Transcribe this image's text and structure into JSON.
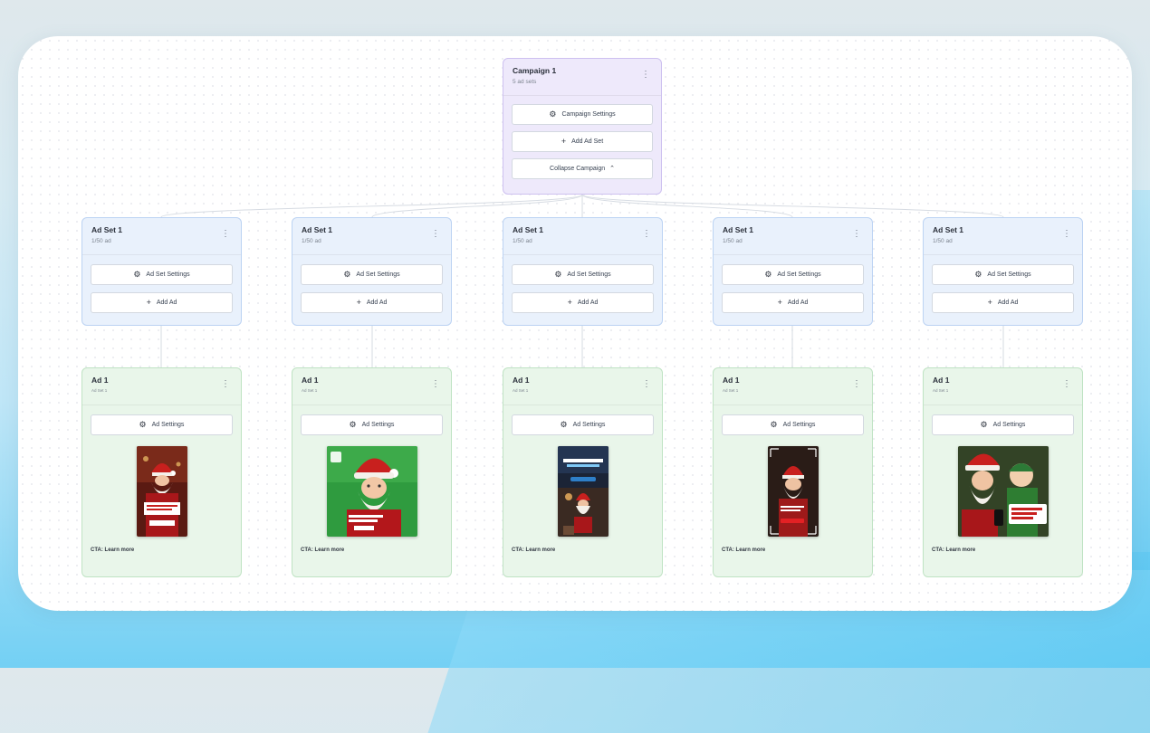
{
  "campaign": {
    "title": "Campaign 1",
    "subtitle": "5 ad sets",
    "settings_label": "Campaign Settings",
    "add_adset_label": "Add Ad Set",
    "collapse_label": "Collapse Campaign"
  },
  "adsets": [
    {
      "title": "Ad Set 1",
      "subtitle": "1/50 ad",
      "settings_label": "Ad Set Settings",
      "add_ad_label": "Add Ad"
    },
    {
      "title": "Ad Set 1",
      "subtitle": "1/50 ad",
      "settings_label": "Ad Set Settings",
      "add_ad_label": "Add Ad"
    },
    {
      "title": "Ad Set 1",
      "subtitle": "1/50 ad",
      "settings_label": "Ad Set Settings",
      "add_ad_label": "Add Ad"
    },
    {
      "title": "Ad Set 1",
      "subtitle": "1/50 ad",
      "settings_label": "Ad Set Settings",
      "add_ad_label": "Add Ad"
    },
    {
      "title": "Ad Set 1",
      "subtitle": "1/50 ad",
      "settings_label": "Ad Set Settings",
      "add_ad_label": "Add Ad"
    }
  ],
  "ads": [
    {
      "title": "Ad 1",
      "subtitle": "Ad Set 1",
      "settings_label": "Ad Settings",
      "cta": "CTA: Learn more",
      "creative_caption": "Santa Claus"
    },
    {
      "title": "Ad 1",
      "subtitle": "Ad Set 1",
      "settings_label": "Ad Settings",
      "cta": "CTA: Learn more",
      "creative_caption": "Santa Claus"
    },
    {
      "title": "Ad 1",
      "subtitle": "Ad Set 1",
      "settings_label": "Ad Settings",
      "cta": "CTA: Learn more",
      "creative_caption": "Santa Claus"
    },
    {
      "title": "Ad 1",
      "subtitle": "Ad Set 1",
      "settings_label": "Ad Settings",
      "cta": "CTA: Learn more",
      "creative_caption": "Santa Claus"
    },
    {
      "title": "Ad 1",
      "subtitle": "Ad Set 1",
      "settings_label": "Ad Settings",
      "cta": "CTA: Learn more",
      "creative_caption": "Santa's Getting Your Messages"
    }
  ],
  "icons": {
    "gear": "gear-icon",
    "plus": "plus-icon",
    "chevron_up": "chevron-up-icon",
    "kebab": "kebab-menu-icon"
  },
  "colors": {
    "campaign_bg": "#eee9fb",
    "adset_bg": "#e9f1fc",
    "ad_bg": "#e9f6ea"
  }
}
